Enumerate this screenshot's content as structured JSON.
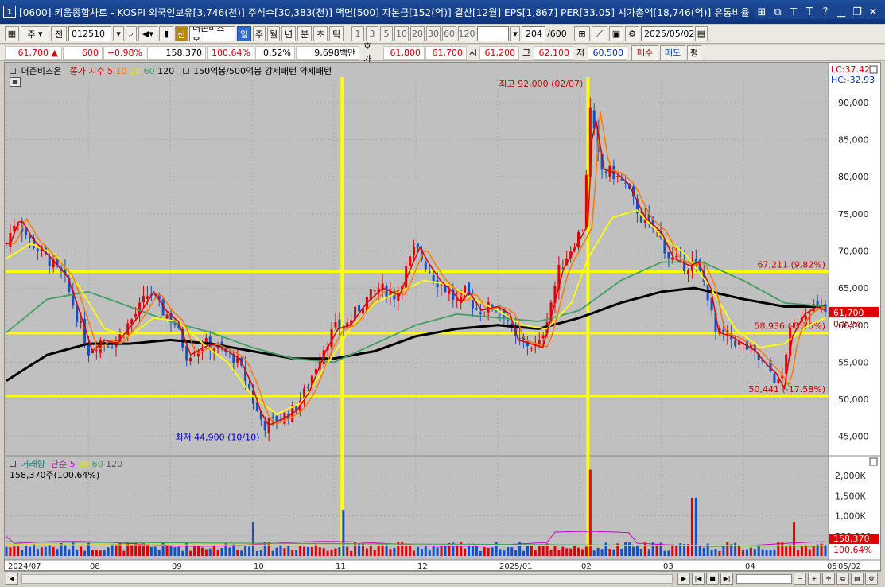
{
  "window": {
    "app_number": "1",
    "title": "[0600] 키움종합차트 - KOSPI 외국인보유[3,746(천)] 주식수[30,383(천)] 액면[500] 자본금[152(억)] 결산[12월] EPS[1,867] PER[33.05] 시가총액[18,746(억)] 유통비율",
    "buttons": [
      "⊞",
      "⧉",
      "⊤",
      "T",
      "?",
      "▁",
      "❐",
      "✕"
    ]
  },
  "toolbar": {
    "code_type": "주",
    "prev_label": "전",
    "stock_code": "012510",
    "stock_badge": "신",
    "stock_name": "더존비즈온",
    "periods": [
      "일",
      "주",
      "월",
      "년",
      "분",
      "초",
      "틱"
    ],
    "active_period": "일",
    "intervals": [
      "1",
      "3",
      "5",
      "10",
      "20",
      "30",
      "60",
      "120"
    ],
    "count_value": "204",
    "count_total": "/600",
    "date_value": "2025/05/02"
  },
  "quote": {
    "price": "61,700",
    "arrow": "▲",
    "change": "600",
    "change_pct": "+0.98%",
    "volume": "158,370",
    "volume_ratio": "100.64%",
    "turnover": "0.52%",
    "amount": "9,698백만",
    "bid_label": "호가",
    "bid1": "61,800",
    "bid2": "61,700",
    "open_label": "시",
    "open": "61,200",
    "high_label": "고",
    "high": "62,100",
    "low_label": "저",
    "low": "60,500",
    "buy_label": "매수",
    "sell_label": "매도",
    "eval_label": "평"
  },
  "price_legend": {
    "name": "더존비즈온",
    "ma_label": "종가 지수",
    "ma5": "5",
    "ma10": "10",
    "ma20": "20",
    "ma60": "60",
    "ma120": "120",
    "extra": "150억봉/500억봉 강세패턴   약세패턴"
  },
  "volume_legend": {
    "name": "거래량",
    "ma_label": "단순",
    "ma5": "5",
    "ma20": "20",
    "ma60": "60",
    "ma120": "120",
    "readout": "158,370주(100.64%)"
  },
  "annotations": {
    "high": "최고 92,000 (02/07)",
    "low": "최저 44,900 (10/10)",
    "lc": "LC:37.42",
    "hc": "HC:-32.93",
    "last_price": "61,700",
    "last_pct": "0.82%",
    "vol_last": "158,370",
    "vol_pct": "100.64%",
    "scroll_date": "05/02"
  },
  "colors": {
    "title_bg": "#1a4590",
    "chart_bg": "#c0c0c0",
    "up": "#e00000",
    "down": "#1050c8",
    "ma5": "#e00000",
    "ma10": "#ff7800",
    "ma20": "#ffff00",
    "ma60": "#40a060",
    "ma120": "#000000",
    "guide": "#ffff00"
  },
  "chart_data": {
    "type": "candlestick",
    "x_months": [
      "2024/07",
      "08",
      "09",
      "10",
      "11",
      "12",
      "2025/01",
      "02",
      "03",
      "04",
      "05"
    ],
    "y_ticks": [
      45000,
      50000,
      55000,
      60000,
      65000,
      70000,
      75000,
      80000,
      85000,
      90000
    ],
    "ylim": [
      42500,
      93000
    ],
    "volume_ticks": [
      "2,000K",
      "1,500K",
      "1,000K",
      "500,000"
    ],
    "volume_max": 2300000,
    "horizontal_levels": [
      {
        "price": 67211,
        "label": "67,211 (9.82%)"
      },
      {
        "price": 58936,
        "label": "58,936 (-3.70%)"
      },
      {
        "price": 50441,
        "label": "50,441 (-17.58%)"
      }
    ],
    "vertical_markers_month_pos": [
      4.1,
      7.1
    ],
    "close_path": [
      [
        0,
        71000
      ],
      [
        0.12,
        74500
      ],
      [
        0.28,
        71500
      ],
      [
        0.5,
        69000
      ],
      [
        0.7,
        66500
      ],
      [
        0.9,
        60000
      ],
      [
        1.0,
        56500
      ],
      [
        1.15,
        58000
      ],
      [
        1.3,
        57500
      ],
      [
        1.55,
        61000
      ],
      [
        1.75,
        64500
      ],
      [
        1.9,
        62000
      ],
      [
        2.05,
        60500
      ],
      [
        2.2,
        56000
      ],
      [
        2.45,
        57500
      ],
      [
        2.65,
        56500
      ],
      [
        2.8,
        55500
      ],
      [
        2.95,
        52000
      ],
      [
        3.05,
        48500
      ],
      [
        3.15,
        46500
      ],
      [
        3.35,
        47500
      ],
      [
        3.5,
        48500
      ],
      [
        3.65,
        51000
      ],
      [
        3.85,
        56500
      ],
      [
        4.0,
        59500
      ],
      [
        4.15,
        60000
      ],
      [
        4.35,
        63000
      ],
      [
        4.55,
        65000
      ],
      [
        4.75,
        64000
      ],
      [
        4.9,
        68000
      ],
      [
        5.0,
        70500
      ],
      [
        5.1,
        68500
      ],
      [
        5.25,
        66000
      ],
      [
        5.4,
        64500
      ],
      [
        5.5,
        63000
      ],
      [
        5.6,
        64500
      ],
      [
        5.75,
        62000
      ],
      [
        5.95,
        62500
      ],
      [
        6.1,
        61500
      ],
      [
        6.2,
        58000
      ],
      [
        6.35,
        57500
      ],
      [
        6.5,
        57000
      ],
      [
        6.6,
        61000
      ],
      [
        6.75,
        67500
      ],
      [
        6.95,
        71500
      ],
      [
        7.05,
        73500
      ],
      [
        7.12,
        89500
      ],
      [
        7.25,
        81000
      ],
      [
        7.4,
        80500
      ],
      [
        7.55,
        79000
      ],
      [
        7.75,
        74500
      ],
      [
        7.95,
        72500
      ],
      [
        8.1,
        69000
      ],
      [
        8.3,
        68000
      ],
      [
        8.4,
        68500
      ],
      [
        8.55,
        65000
      ],
      [
        8.65,
        59000
      ],
      [
        8.8,
        58500
      ],
      [
        8.95,
        57500
      ],
      [
        9.1,
        56500
      ],
      [
        9.25,
        54500
      ],
      [
        9.35,
        53500
      ],
      [
        9.45,
        51500
      ],
      [
        9.55,
        58500
      ],
      [
        9.7,
        61500
      ],
      [
        9.85,
        62500
      ],
      [
        10.0,
        61700
      ]
    ],
    "ma20_path": [
      [
        0,
        69000
      ],
      [
        0.3,
        71000
      ],
      [
        0.6,
        69500
      ],
      [
        0.9,
        65000
      ],
      [
        1.2,
        59500
      ],
      [
        1.5,
        58500
      ],
      [
        1.8,
        61000
      ],
      [
        2.1,
        60500
      ],
      [
        2.4,
        57500
      ],
      [
        2.7,
        55000
      ],
      [
        3.0,
        50500
      ],
      [
        3.3,
        48000
      ],
      [
        3.6,
        49500
      ],
      [
        3.9,
        54500
      ],
      [
        4.2,
        59500
      ],
      [
        4.5,
        63000
      ],
      [
        4.8,
        64500
      ],
      [
        5.1,
        66000
      ],
      [
        5.4,
        65500
      ],
      [
        5.7,
        63500
      ],
      [
        6.0,
        62000
      ],
      [
        6.3,
        60000
      ],
      [
        6.6,
        59500
      ],
      [
        6.9,
        63000
      ],
      [
        7.1,
        69000
      ],
      [
        7.4,
        74500
      ],
      [
        7.7,
        75500
      ],
      [
        8.0,
        72000
      ],
      [
        8.3,
        69500
      ],
      [
        8.6,
        65000
      ],
      [
        8.9,
        59500
      ],
      [
        9.2,
        57000
      ],
      [
        9.5,
        57500
      ],
      [
        9.8,
        60000
      ],
      [
        10.0,
        61000
      ]
    ],
    "ma60_path": [
      [
        0,
        59000
      ],
      [
        0.5,
        63500
      ],
      [
        1.0,
        64500
      ],
      [
        1.5,
        62500
      ],
      [
        2.0,
        60500
      ],
      [
        2.5,
        59000
      ],
      [
        3.0,
        57000
      ],
      [
        3.5,
        55500
      ],
      [
        4.0,
        55000
      ],
      [
        4.5,
        57500
      ],
      [
        5.0,
        60000
      ],
      [
        5.5,
        61500
      ],
      [
        6.0,
        61000
      ],
      [
        6.5,
        60500
      ],
      [
        7.0,
        62000
      ],
      [
        7.5,
        66000
      ],
      [
        8.0,
        68500
      ],
      [
        8.5,
        68500
      ],
      [
        9.0,
        66000
      ],
      [
        9.5,
        63000
      ],
      [
        10.0,
        62500
      ]
    ],
    "ma120_path": [
      [
        0,
        52500
      ],
      [
        0.5,
        56000
      ],
      [
        1.0,
        57500
      ],
      [
        1.5,
        57500
      ],
      [
        2.0,
        58000
      ],
      [
        2.5,
        57500
      ],
      [
        3.0,
        56500
      ],
      [
        3.5,
        55500
      ],
      [
        4.0,
        55500
      ],
      [
        4.5,
        56500
      ],
      [
        5.0,
        58500
      ],
      [
        5.5,
        59500
      ],
      [
        6.0,
        60000
      ],
      [
        6.5,
        59500
      ],
      [
        7.0,
        61000
      ],
      [
        7.5,
        63000
      ],
      [
        8.0,
        64500
      ],
      [
        8.4,
        65000
      ],
      [
        9.0,
        63500
      ],
      [
        9.5,
        62500
      ],
      [
        10.0,
        62500
      ]
    ],
    "volume_spikes": [
      {
        "pos": 3.0,
        "value": 850000
      },
      {
        "pos": 4.1,
        "value": 1150000
      },
      {
        "pos": 7.12,
        "value": 2150000
      },
      {
        "pos": 8.4,
        "value": 1450000
      },
      {
        "pos": 9.6,
        "value": 850000
      }
    ]
  }
}
